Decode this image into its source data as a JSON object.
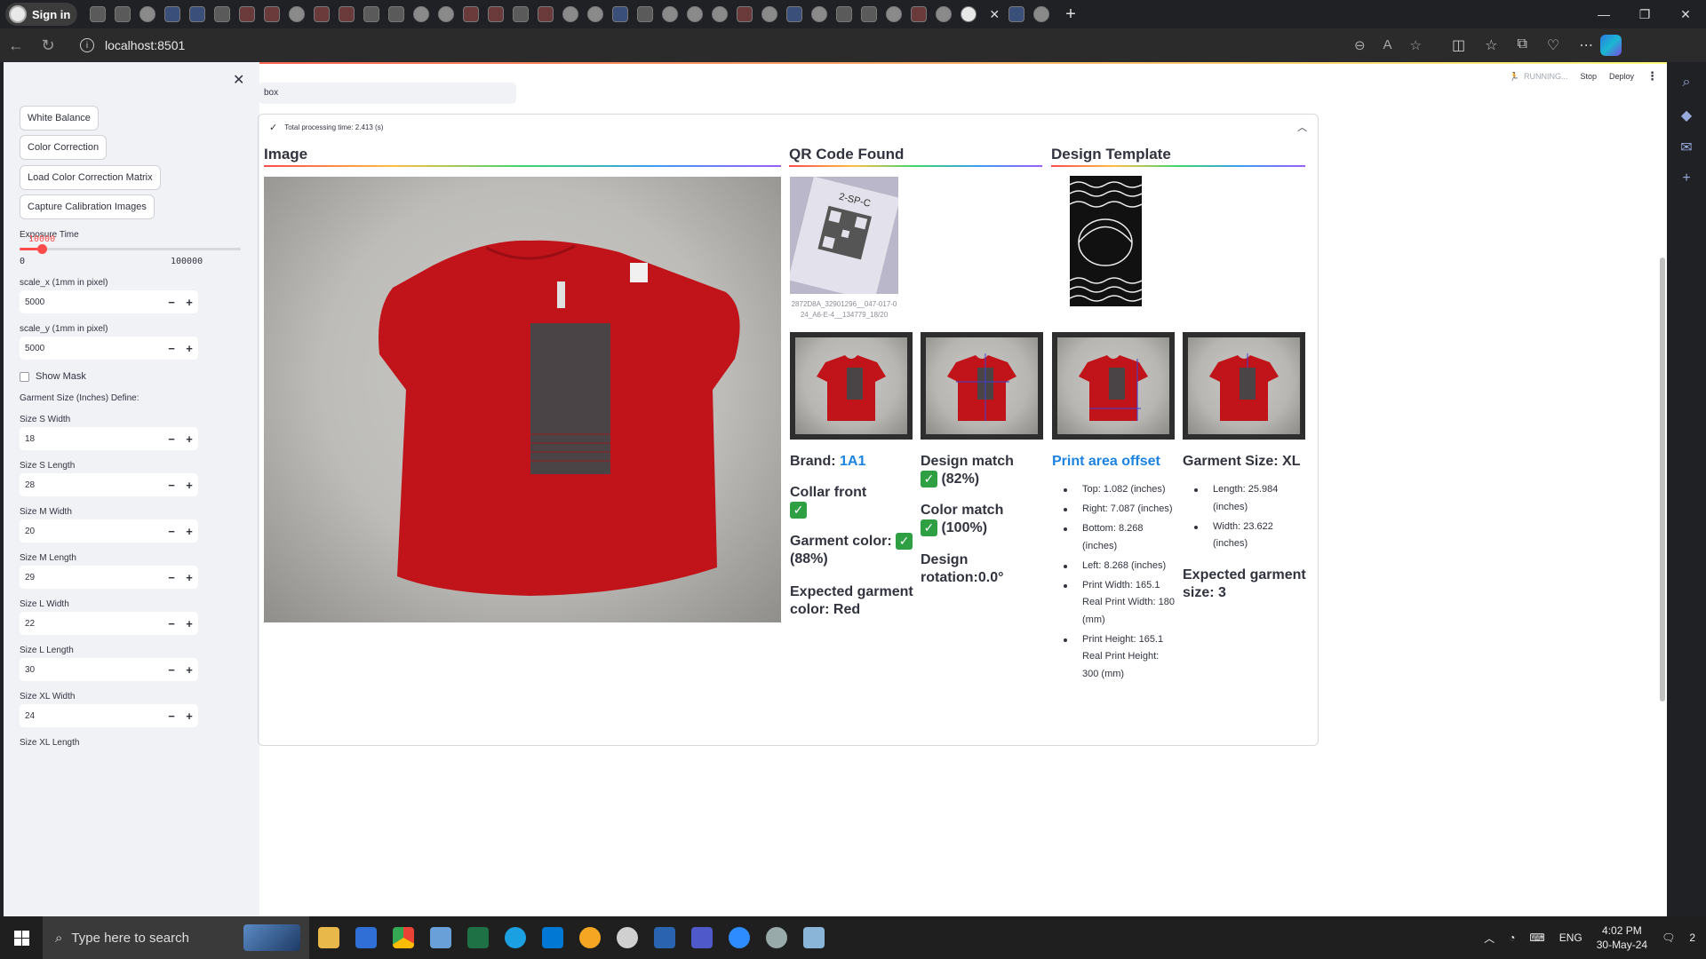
{
  "browser": {
    "profile_label": "Sign in",
    "url": "localhost:8501"
  },
  "app": {
    "close_glyph": "✕",
    "status_running": "RUNNING...",
    "stop_label": "Stop",
    "deploy_label": "Deploy",
    "menu_glyph": "⋮"
  },
  "sidebar": {
    "buttons": [
      "White Balance",
      "Color Correction",
      "Load Color Correction Matrix",
      "Capture Calibration Images"
    ],
    "exposure": {
      "label": "Exposure Time",
      "value": "10000",
      "min": "0",
      "max": "100000",
      "fraction": 0.1
    },
    "scale_x": {
      "label": "scale_x (1mm in pixel)",
      "value": "5000"
    },
    "scale_y": {
      "label": "scale_y (1mm in pixel)",
      "value": "5000"
    },
    "show_mask": {
      "label": "Show Mask",
      "checked": false
    },
    "size_header": "Garment Size (Inches) Define:",
    "sizes": [
      {
        "label": "Size S Width",
        "value": "18"
      },
      {
        "label": "Size S Length",
        "value": "28"
      },
      {
        "label": "Size M Width",
        "value": "20"
      },
      {
        "label": "Size M Length",
        "value": "29"
      },
      {
        "label": "Size L Width",
        "value": "22"
      },
      {
        "label": "Size L Length",
        "value": "30"
      },
      {
        "label": "Size XL Width",
        "value": "24"
      }
    ],
    "last_label": "Size XL Length"
  },
  "main": {
    "text_input": "box",
    "status": "Total processing time: 2.413 (s)",
    "headings": {
      "image": "Image",
      "qr": "QR Code Found",
      "template": "Design Template"
    },
    "qr_caption": "2872D8A_32901296__047-017-024_A6-E-4__134779_18/20",
    "qr_tag_text": "2-SP-C",
    "brand_label": "Brand:",
    "brand_value": "1A1",
    "collar": "Collar front",
    "garment_color_label": "Garment color:",
    "garment_color_pct": "(88%)",
    "expected_color": "Expected garment color: Red",
    "design_match": "Design match",
    "design_match_pct": "(82%)",
    "color_match": "Color match",
    "color_match_pct": "(100%)",
    "rotation": "Design rotation:0.0°",
    "print_offset_title": "Print area offset",
    "offsets": [
      "Top: 1.082 (inches)",
      "Right: 7.087 (inches)",
      "Bottom: 8.268 (inches)",
      "Left: 8.268 (inches)",
      "Print Width: 165.1 Real Print Width: 180 (mm)",
      "Print Height: 165.1 Real Print Height: 300 (mm)"
    ],
    "garment_size": "Garment Size: XL",
    "sizes_measured": [
      "Length: 25.984 (inches)",
      "Width: 23.622 (inches)"
    ],
    "expected_size": "Expected garment size: 3"
  },
  "taskbar": {
    "search_placeholder": "Type here to search",
    "language": "ENG",
    "time": "4:02 PM",
    "date": "30-May-24",
    "notification_count": "2"
  },
  "colors": {
    "accent": "#ff4b4b",
    "link": "#1c83e1",
    "shirt": "#c0141a",
    "check": "#2ea043"
  }
}
